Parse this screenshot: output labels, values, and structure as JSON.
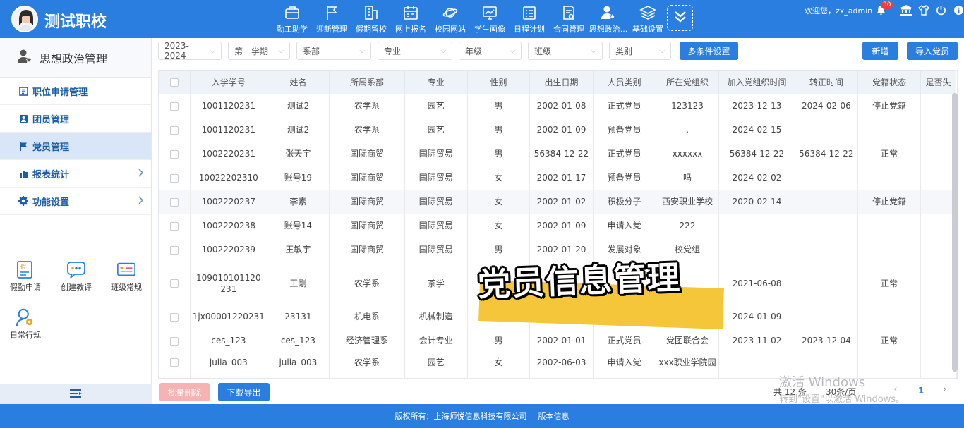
{
  "app": {
    "school_name": "测试职校"
  },
  "nav": [
    {
      "label": "勤工助学",
      "icon": "briefcase-icon"
    },
    {
      "label": "迎新管理",
      "icon": "flag-icon"
    },
    {
      "label": "假期留校",
      "icon": "building-icon"
    },
    {
      "label": "网上报名",
      "icon": "calendar-form-icon"
    },
    {
      "label": "校园网站",
      "icon": "planet-icon"
    },
    {
      "label": "学生画像",
      "icon": "monitor-chart-icon"
    },
    {
      "label": "日程计划",
      "icon": "schedule-icon"
    },
    {
      "label": "合同管理",
      "icon": "contract-icon"
    },
    {
      "label": "思想政治...",
      "icon": "user-star-icon"
    },
    {
      "label": "基础设置",
      "icon": "layers-icon"
    }
  ],
  "user": {
    "welcome": "欢迎您，zx_admin",
    "notifications": "30"
  },
  "sidebar": {
    "title": "思想政治管理",
    "items": [
      {
        "label": "职位申请管理"
      },
      {
        "label": "团员管理"
      },
      {
        "label": "党员管理"
      },
      {
        "label": "报表统计"
      },
      {
        "label": "功能设置"
      }
    ],
    "quick": [
      {
        "label": "假勤申请"
      },
      {
        "label": "创建教评"
      },
      {
        "label": "班级常规"
      },
      {
        "label": "日常行规"
      }
    ]
  },
  "filters": {
    "year": "2023-2024",
    "semester": "第一学期",
    "department": "系部",
    "major": "专业",
    "grade": "年级",
    "class": "班级",
    "category": "类别",
    "multi_btn": "多条件设置",
    "add_btn": "新增",
    "import_btn": "导入党员"
  },
  "table": {
    "headers": [
      "入学学号",
      "姓名",
      "所属系部",
      "专业",
      "性别",
      "出生日期",
      "人员类别",
      "所在党组织",
      "加入党组织时间",
      "转正时间",
      "党籍状态",
      "是否失"
    ],
    "rows": [
      [
        "1001120231",
        "测试2",
        "农学系",
        "园艺",
        "男",
        "2002-01-08",
        "正式党员",
        "123123",
        "2023-12-13",
        "2024-02-06",
        "停止党籍",
        ""
      ],
      [
        "1001120231",
        "测试2",
        "农学系",
        "园艺",
        "男",
        "2002-01-09",
        "预备党员",
        ",",
        "2024-02-15",
        "",
        "",
        ""
      ],
      [
        "1002220231",
        "张天宇",
        "国际商贸",
        "国际贸易",
        "男",
        "56384-12-22",
        "正式党员",
        "xxxxxx",
        "56384-12-22",
        "56384-12-22",
        "正常",
        ""
      ],
      [
        "10022202310",
        "账号19",
        "国际商贸",
        "国际贸易",
        "女",
        "2002-01-17",
        "预备党员",
        "吗",
        "2024-02-02",
        "",
        "",
        ""
      ],
      [
        "1002220237",
        "李素",
        "国际商贸",
        "国际贸易",
        "女",
        "2002-01-02",
        "积极分子",
        "西安职业学校",
        "2020-02-14",
        "",
        "停止党籍",
        ""
      ],
      [
        "1002220238",
        "账号14",
        "国际商贸",
        "国际贸易",
        "女",
        "2002-01-09",
        "申请入党",
        "222",
        "",
        "",
        "",
        ""
      ],
      [
        "1002220239",
        "王敏宇",
        "国际商贸",
        "国际贸易",
        "男",
        "2002-01-20",
        "发展对象",
        "校党组",
        "",
        "",
        "",
        ""
      ],
      [
        "109010101120231",
        "王刚",
        "农学系",
        "茶学",
        "",
        "",
        "",
        "",
        "2021-06-08",
        "",
        "正常",
        ""
      ],
      [
        "1jx00001220231",
        "23131",
        "机电系",
        "机械制造",
        "",
        "",
        "",
        "",
        "2024-01-09",
        "",
        "",
        ""
      ],
      [
        "ces_123",
        "ces_123",
        "经济管理系",
        "会计专业",
        "男",
        "2002-01-01",
        "正式党员",
        "党团联合会",
        "2023-11-02",
        "2023-12-04",
        "正常",
        ""
      ],
      [
        "julia_003",
        "julia_003",
        "农学系",
        "园艺",
        "女",
        "2002-06-03",
        "申请入党",
        "xxx职业学院园",
        "",
        "",
        "",
        ""
      ]
    ]
  },
  "actions": {
    "batch_delete": "批量删除",
    "download_export": "下载导出"
  },
  "pager": {
    "total": "共 12 条",
    "per_page": "30条/页",
    "current": "1",
    "prev": "‹",
    "next": "›"
  },
  "overlay": {
    "caption": "党员信息管理"
  },
  "watermark": {
    "line1": "激活 Windows",
    "line2": "转到\"设置\"以激活 Windows。"
  },
  "footer": {
    "copyright": "版权所有：上海师悦信息科技有限公司",
    "version": "版本信息"
  },
  "colors": {
    "primary": "#2a7ee0",
    "sidebar_text": "#1d5ea8",
    "danger_light": "#f7b3b3",
    "highlight": "#f5c63a"
  }
}
